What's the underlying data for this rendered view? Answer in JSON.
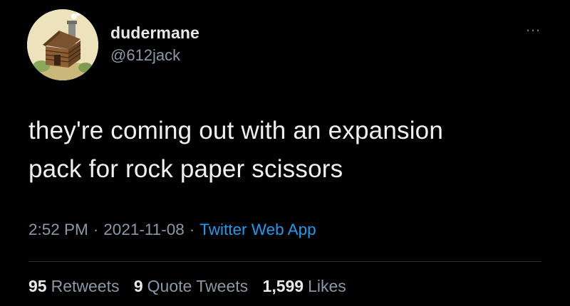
{
  "author": {
    "display_name": "dudermane",
    "handle": "@612jack",
    "avatar_icon": "log-cabin-avatar-icon"
  },
  "more_icon": "…",
  "tweet": {
    "text_line1": "they're coming out with an expansion",
    "text_line2": "pack for rock paper scissors"
  },
  "meta": {
    "time": "2:52 PM",
    "separator": "·",
    "date": "2021-11-08",
    "source": "Twitter Web App"
  },
  "stats": {
    "retweets_count": "95",
    "retweets_label": "Retweets",
    "quotes_count": "9",
    "quotes_label": "Quote Tweets",
    "likes_count": "1,599",
    "likes_label": "Likes"
  },
  "colors": {
    "background": "#000000",
    "text_primary": "#e7e9ea",
    "text_secondary": "#8b98a5",
    "link": "#1d9bf0",
    "divider": "#2f3336"
  }
}
